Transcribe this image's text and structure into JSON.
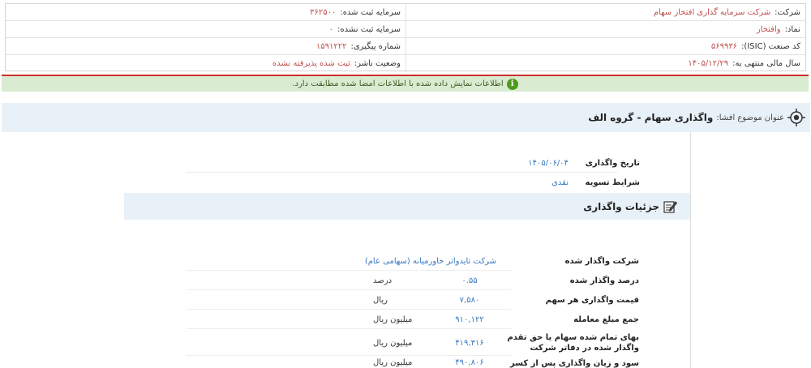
{
  "company_info": {
    "company_label": "شرکت:",
    "company_value": "شرکت سرمایه گذاری افتخار سهام",
    "registered_capital_label": "سرمایه ثبت شده:",
    "registered_capital_value": "۳۶۲۵۰۰",
    "symbol_label": "نماد:",
    "symbol_value": "وافتخار",
    "unregistered_capital_label": "سرمایه ثبت نشده:",
    "unregistered_capital_value": "۰",
    "isic_label": "کد صنعت (ISIC):",
    "isic_value": "۵۶۹۹۳۶",
    "tracking_label": "شماره پیگیری:",
    "tracking_value": "۱۵۹۱۲۲۲",
    "fiscal_year_label": "سال مالی منتهی به:",
    "fiscal_year_value": "۱۴۰۵/۱۲/۲۹",
    "publisher_status_label": "وضعیت ناشر:",
    "publisher_status_value": "ثبت شده پذیرفته نشده"
  },
  "alert": {
    "icon": "info-icon",
    "text": "اطلاعات نمایش داده شده با اطلاعات امضا شده مطابقت دارد."
  },
  "disclosure": {
    "subject_label": "عنوان موضوع افشا:",
    "subject_title": "واگذاری سهام - گروه الف"
  },
  "summary": {
    "transfer_date_label": "تاریخ واگذاری",
    "transfer_date_value": "۱۴۰۵/۰۶/۰۴",
    "settlement_label": "شرایط تسویه",
    "settlement_value": "نقدی"
  },
  "details": {
    "section_title": "جزئیات واگذاری",
    "rows": [
      {
        "label": "شرکت واگذار شده",
        "value": "شرکت تایدواتر خاورمیانه (سهامی عام)",
        "unit": ""
      },
      {
        "label": "درصد واگذار شده",
        "value": "۰.۵۵",
        "unit": "درصد"
      },
      {
        "label": "قیمت واگذاری هر سهم",
        "value": "۷,۵۸۰",
        "unit": "ریال"
      },
      {
        "label": "جمع مبلغ معامله",
        "value": "۹۱۰,۱۲۲",
        "unit": "میلیون ریال"
      },
      {
        "label": "بهای تمام شده سهام یا حق تقدم واگذار شده در دفاتر شرکت",
        "value": "۴۱۹,۳۱۶",
        "unit": "میلیون ریال"
      },
      {
        "label": "سود و زیان واگذاری پس از کسر مخارج انتقال",
        "value": "۴۹۰,۸۰۶",
        "unit": "میلیون ریال"
      }
    ]
  }
}
